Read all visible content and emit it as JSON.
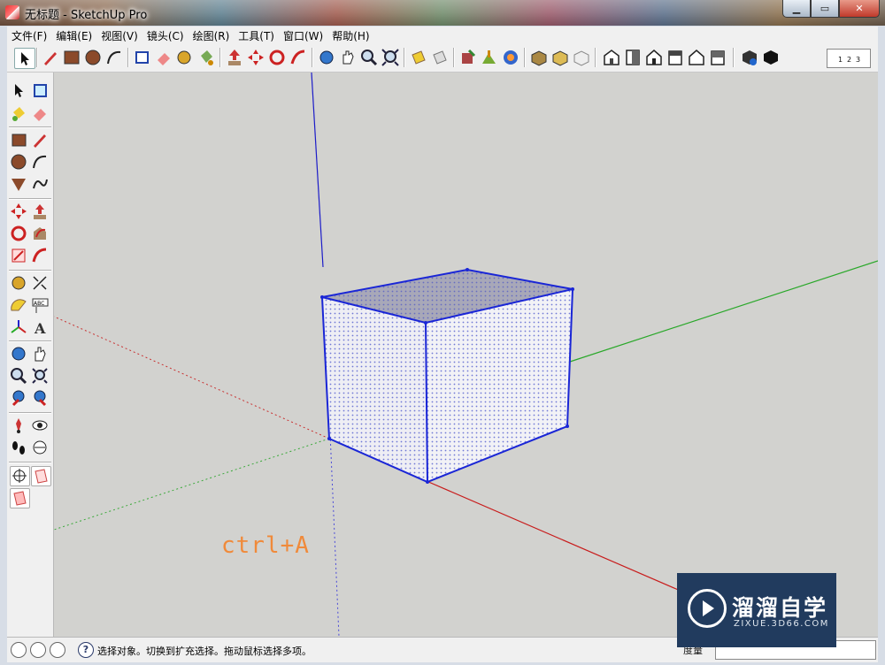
{
  "window": {
    "title": "无标题 - SketchUp Pro"
  },
  "menu": [
    "文件(F)",
    "编辑(E)",
    "视图(V)",
    "镜头(C)",
    "绘图(R)",
    "工具(T)",
    "窗口(W)",
    "帮助(H)"
  ],
  "status": {
    "hint": "选择对象。切换到扩充选择。拖动鼠标选择多项。",
    "measure_label": "度量"
  },
  "annotation": "ctrl+A",
  "watermark": {
    "title": "溜溜自学",
    "url": "ZIXUE.3D66.COM"
  },
  "ruler": [
    "1",
    "2",
    "3"
  ],
  "colors": {
    "axis_blue": "#1c1cc8",
    "axis_red": "#c81c1c",
    "axis_green": "#2aa82a",
    "selection": "#1a26d6",
    "annotation": "#f08a3a"
  },
  "icons": [
    "select-icon",
    "component-icon",
    "paint-bucket-icon",
    "eraser-icon",
    "rectangle-icon",
    "pencil-icon",
    "circle-icon",
    "arc-icon",
    "polygon-icon",
    "freehand-icon",
    "move-icon",
    "push-pull-icon",
    "rotate-icon",
    "follow-me-icon",
    "scale-icon",
    "offset-icon",
    "tape-measure-icon",
    "dimension-icon",
    "protractor-icon",
    "text-icon",
    "axes-icon",
    "3d-text-icon",
    "orbit-icon",
    "pan-icon",
    "zoom-icon",
    "zoom-extents-icon",
    "previous-view-icon",
    "next-view-icon",
    "walk-icon",
    "look-around-icon",
    "position-camera-icon",
    "section-plane-icon",
    "help-icon"
  ]
}
